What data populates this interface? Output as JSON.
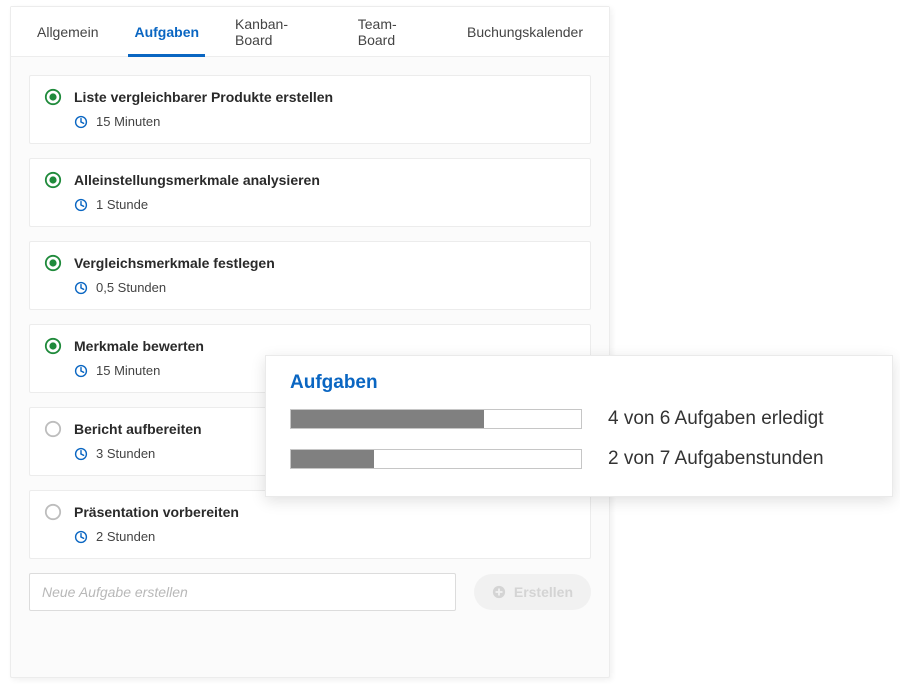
{
  "tabs": [
    {
      "label": "Allgemein",
      "active": false
    },
    {
      "label": "Aufgaben",
      "active": true
    },
    {
      "label": "Kanban-Board",
      "active": false
    },
    {
      "label": "Team-Board",
      "active": false
    },
    {
      "label": "Buchungskalender",
      "active": false
    }
  ],
  "tasks": [
    {
      "title": "Liste vergleichbarer Produkte erstellen",
      "duration": "15 Minuten",
      "done": true
    },
    {
      "title": "Alleinstellungsmerkmale analysieren",
      "duration": "1 Stunde",
      "done": true
    },
    {
      "title": "Vergleichsmerkmale festlegen",
      "duration": "0,5 Stunden",
      "done": true
    },
    {
      "title": "Merkmale bewerten",
      "duration": "15 Minuten",
      "done": true
    },
    {
      "title": "Bericht aufbereiten",
      "duration": "3 Stunden",
      "done": false
    },
    {
      "title": "Präsentation vorbereiten",
      "duration": "2 Stunden",
      "done": false
    }
  ],
  "newTask": {
    "placeholder": "Neue Aufgabe erstellen",
    "createLabel": "Erstellen"
  },
  "overlay": {
    "title": "Aufgaben",
    "rows": [
      {
        "label": "4 von 6 Aufgaben erledigt",
        "percent": 66.7
      },
      {
        "label": "2 von 7 Aufgabenstunden",
        "percent": 28.6
      }
    ]
  },
  "colors": {
    "accent": "#0a66c2",
    "green": "#1f8a3b"
  }
}
